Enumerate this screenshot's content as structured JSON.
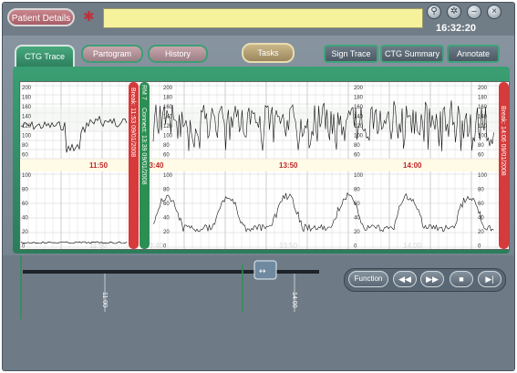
{
  "header": {
    "patient_details_label": "Patient Details",
    "clock": "16:32:20",
    "window_buttons": [
      "search-icon",
      "settings-icon",
      "minimize-icon",
      "close-icon"
    ]
  },
  "tabs": [
    {
      "label": "CTG Trace",
      "active": true
    },
    {
      "label": "Partogram",
      "active": false
    },
    {
      "label": "History",
      "active": false
    }
  ],
  "tasks_label": "Tasks",
  "toolbar_right": [
    "Sign Trace",
    "CTG Summary",
    "Annotate"
  ],
  "trace": {
    "fhr_scale": [
      "200",
      "180",
      "160",
      "140",
      "120",
      "100",
      "80",
      "60"
    ],
    "toco_scale": [
      "100",
      "80",
      "60",
      "40",
      "20",
      "0"
    ],
    "time_labels": [
      "11:50",
      "13:40",
      "13:50",
      "14:00"
    ],
    "break_marker_1": "Break: 11:53 09/01/2008",
    "connect_marker": "Connect: 13:39 09/01/2008",
    "rm_label": "RM 7",
    "break_marker_2": "Break: 14:06 09/01/2008"
  },
  "timeline": {
    "labels": [
      "11:00",
      "14:00"
    ],
    "handle_icon": "double-arrow-icon"
  },
  "controls": {
    "function_label": "Function",
    "buttons": [
      "rewind-icon",
      "fast-forward-icon",
      "stop-icon",
      "skip-end-icon"
    ]
  },
  "colors": {
    "frame_green": "#3a9f73",
    "marker_red": "#d63a3a",
    "marker_green": "#2a8f52",
    "time_label_red": "#c0262b",
    "field_yellow": "#f6f29c"
  }
}
